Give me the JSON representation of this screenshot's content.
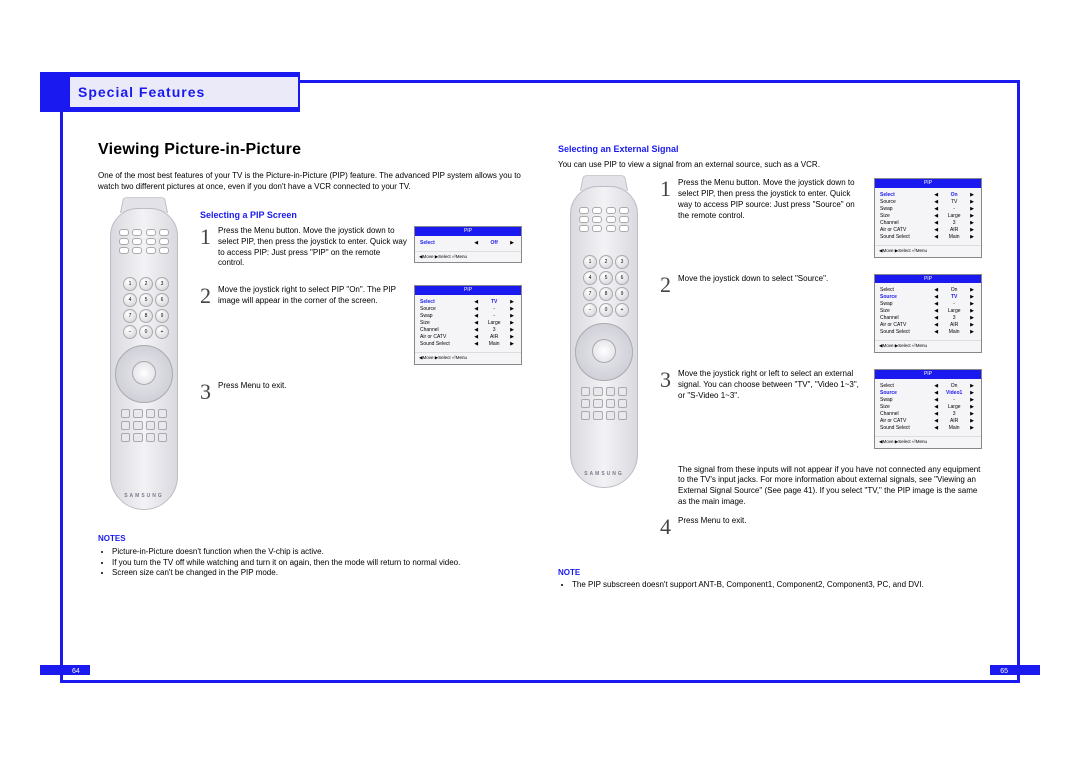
{
  "header": {
    "section_title": "Special Features"
  },
  "left": {
    "page_title": "Viewing Picture-in-Picture",
    "intro": "One of the most best features of your TV is the Picture-in-Picture (PIP) feature. The advanced PIP system allows you to watch two different pictures at once, even if you don't have a VCR connected to your TV.",
    "subhead": "Selecting a PIP Screen",
    "remote_brand": "SAMSUNG",
    "steps": [
      {
        "num": "1",
        "text": "Press the Menu button. Move the joystick down to select PIP, then press the joystick to enter.\nQuick way to access PIP: Just press \"PIP\" on the remote control.",
        "osd": {
          "title": "PIP",
          "rows": [
            {
              "k": "Select",
              "v": "Off",
              "sel": true
            }
          ],
          "foot": "◀Move ▶Select ⏎Menu"
        }
      },
      {
        "num": "2",
        "text": "Move the joystick right to select PIP \"On\". The PIP image will appear in the corner of the screen.",
        "osd": {
          "title": "PIP",
          "rows": [
            {
              "k": "Select",
              "v": "TV",
              "sel": true
            },
            {
              "k": "Source",
              "v": "-"
            },
            {
              "k": "Swap",
              "v": "-"
            },
            {
              "k": "Size",
              "v": "Large"
            },
            {
              "k": "Channel",
              "v": "3"
            },
            {
              "k": "Air or CATV",
              "v": "AIR"
            },
            {
              "k": "Sound Select",
              "v": "Main"
            }
          ],
          "foot": "◀Move ▶Select ⏎Menu"
        }
      },
      {
        "num": "3",
        "text": "Press Menu to exit.",
        "osd": null
      }
    ],
    "notes_head": "NOTES",
    "notes": [
      "Picture-in-Picture doesn't function when the V-chip is active.",
      "If you turn the TV off while watching and turn it on again, then the mode will return to normal video.",
      "Screen size can't be changed in the PIP mode."
    ],
    "page_number": "64"
  },
  "right": {
    "subhead": "Selecting an External Signal",
    "intro": "You can use PIP to view a signal from an external source, such as a VCR.",
    "remote_brand": "SAMSUNG",
    "steps": [
      {
        "num": "1",
        "text": "Press the Menu button. Move the joystick down to select PIP, then press the joystick to enter. Quick way to access PIP source:  Just press \"Source\" on the remote control.",
        "osd": {
          "title": "PIP",
          "rows": [
            {
              "k": "Select",
              "v": "On",
              "sel": true
            },
            {
              "k": "Source",
              "v": "TV"
            },
            {
              "k": "Swap",
              "v": "-"
            },
            {
              "k": "Size",
              "v": "Large"
            },
            {
              "k": "Channel",
              "v": "3"
            },
            {
              "k": "Air or CATV",
              "v": "AIR"
            },
            {
              "k": "Sound Select",
              "v": "Main"
            }
          ],
          "foot": "◀Move ▶Select ⏎Menu"
        }
      },
      {
        "num": "2",
        "text": "Move the joystick down to select \"Source\".",
        "osd": {
          "title": "PIP",
          "rows": [
            {
              "k": "Select",
              "v": "On"
            },
            {
              "k": "Source",
              "v": "TV",
              "sel": true
            },
            {
              "k": "Swap",
              "v": "-"
            },
            {
              "k": "Size",
              "v": "Large"
            },
            {
              "k": "Channel",
              "v": "3"
            },
            {
              "k": "Air or CATV",
              "v": "AIR"
            },
            {
              "k": "Sound Select",
              "v": "Main"
            }
          ],
          "foot": "◀Move ▶Select ⏎Menu"
        }
      },
      {
        "num": "3",
        "text": "Move the joystick right or left to select an external signal. You can choose between \"TV\", \"Video 1~3\", or \"S-Video 1~3\".",
        "osd": {
          "title": "PIP",
          "rows": [
            {
              "k": "Select",
              "v": "On"
            },
            {
              "k": "Source",
              "v": "Video1",
              "sel": true
            },
            {
              "k": "Swap",
              "v": "-"
            },
            {
              "k": "Size",
              "v": "Large"
            },
            {
              "k": "Channel",
              "v": "3"
            },
            {
              "k": "Air or CATV",
              "v": "AIR"
            },
            {
              "k": "Sound Select",
              "v": "Main"
            }
          ],
          "foot": "◀Move ▶Select ⏎Menu"
        }
      },
      {
        "num": "4",
        "text": "Press Menu to exit.",
        "osd": null
      }
    ],
    "post_text": "The signal from these inputs will not appear if you have not connected any equipment to the TV's input jacks. For more information about external signals, see \"Viewing an External Signal Source\" (See page 41).  If you select \"TV,\" the PIP image is the same as the main image.",
    "notes_head": "NOTE",
    "notes": [
      "The PIP subscreen doesn't support ANT-B, Component1, Component2, Component3, PC, and DVI."
    ],
    "page_number": "65"
  },
  "osd_arrows": {
    "left": "◀",
    "right": "▶"
  },
  "numpad": [
    "1",
    "2",
    "3",
    "4",
    "5",
    "6",
    "7",
    "8",
    "9",
    "−",
    "0",
    "+"
  ]
}
